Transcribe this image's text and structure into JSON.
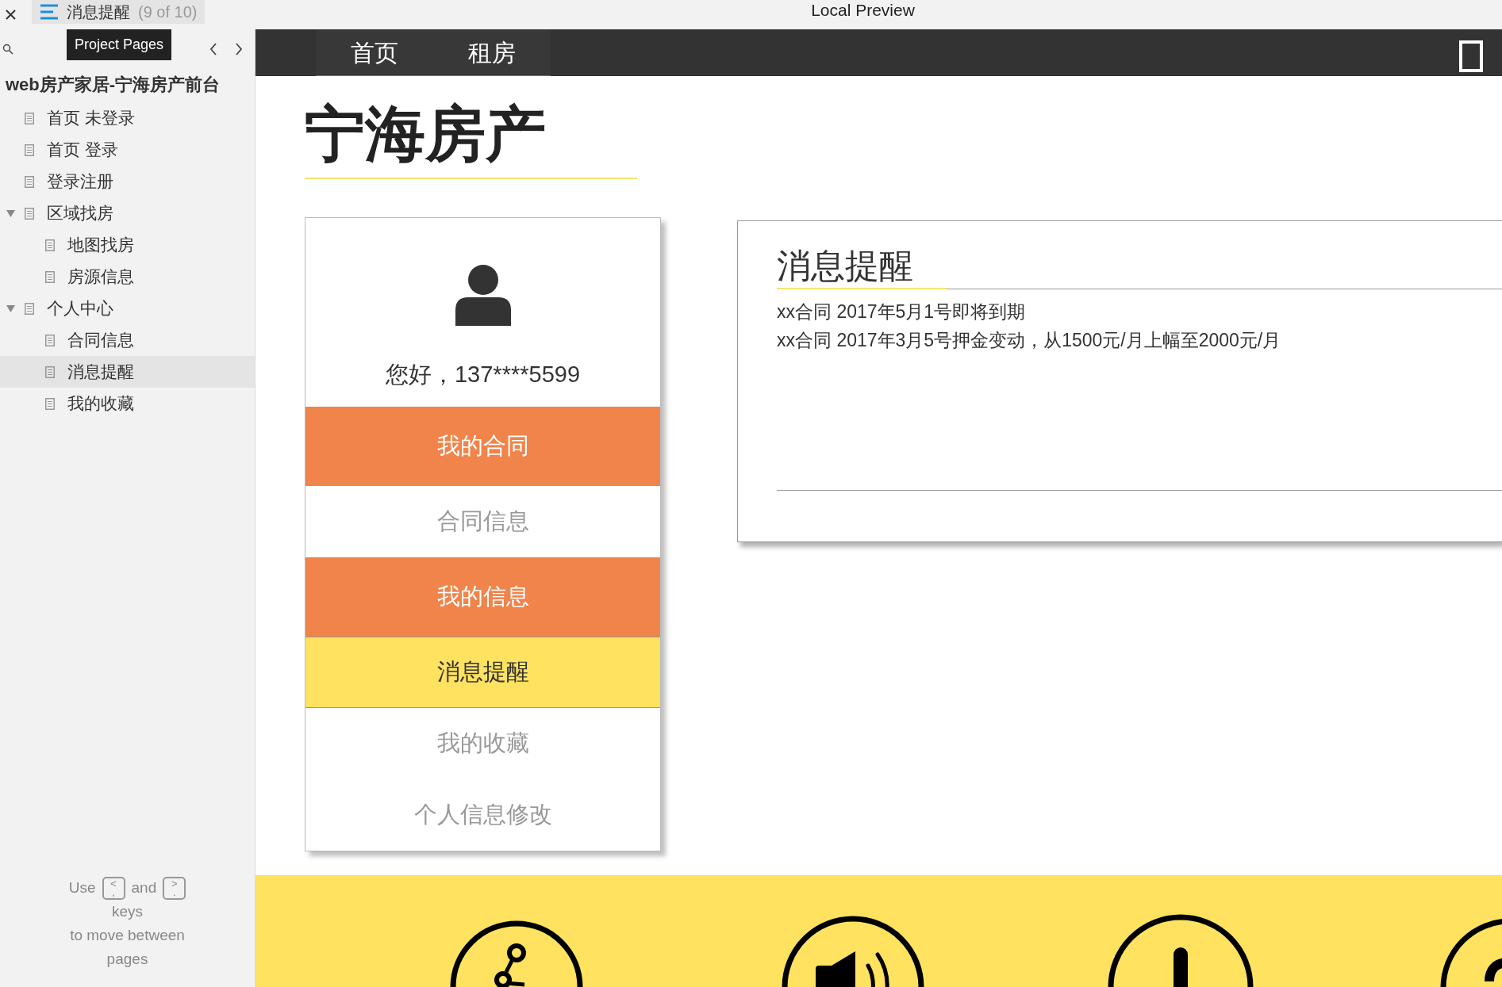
{
  "window": {
    "tab_title": "消息提醒",
    "tab_counter": "(9 of 10)",
    "title": "Local Preview"
  },
  "sidebar": {
    "tooltip": "Project Pages",
    "project": "web房产家居-宁海房产前台",
    "pages": [
      {
        "label": "首页 未登录",
        "selected": false
      },
      {
        "label": "首页 登录",
        "selected": false
      },
      {
        "label": "登录注册",
        "selected": false
      },
      {
        "label": "区域找房",
        "selected": false,
        "expanded": true,
        "children": [
          {
            "label": "地图找房",
            "selected": false
          },
          {
            "label": "房源信息",
            "selected": false
          }
        ]
      },
      {
        "label": "个人中心",
        "selected": false,
        "expanded": true,
        "children": [
          {
            "label": "合同信息",
            "selected": false
          },
          {
            "label": "消息提醒",
            "selected": true
          },
          {
            "label": "我的收藏",
            "selected": false
          }
        ]
      }
    ],
    "help": {
      "use": "Use",
      "key_prev": {
        "top": "<",
        "bottom": ","
      },
      "and": "and",
      "key_next": {
        "top": ">",
        "bottom": "."
      },
      "keys": "keys",
      "line2": "to move between",
      "line3": "pages"
    }
  },
  "site": {
    "nav": [
      {
        "label": "首页"
      },
      {
        "label": "租房"
      }
    ],
    "title": "宁海房产",
    "profile": {
      "greeting": "您好，137****5599",
      "menu": [
        {
          "label": "我的合同",
          "kind": "section",
          "selected": false
        },
        {
          "label": "合同信息",
          "kind": "link",
          "selected": false
        },
        {
          "label": "我的信息",
          "kind": "section",
          "selected": false
        },
        {
          "label": "消息提醒",
          "kind": "link",
          "selected": true
        },
        {
          "label": "我的收藏",
          "kind": "link",
          "selected": false
        },
        {
          "label": "个人信息修改",
          "kind": "link",
          "selected": false
        }
      ]
    },
    "messages": {
      "title": "消息提醒",
      "items": [
        "xx合同 2017年5月1号即将到期",
        "xx合同 2017年3月5号押金变动，从1500元/月上幅至2000元/月"
      ]
    }
  }
}
